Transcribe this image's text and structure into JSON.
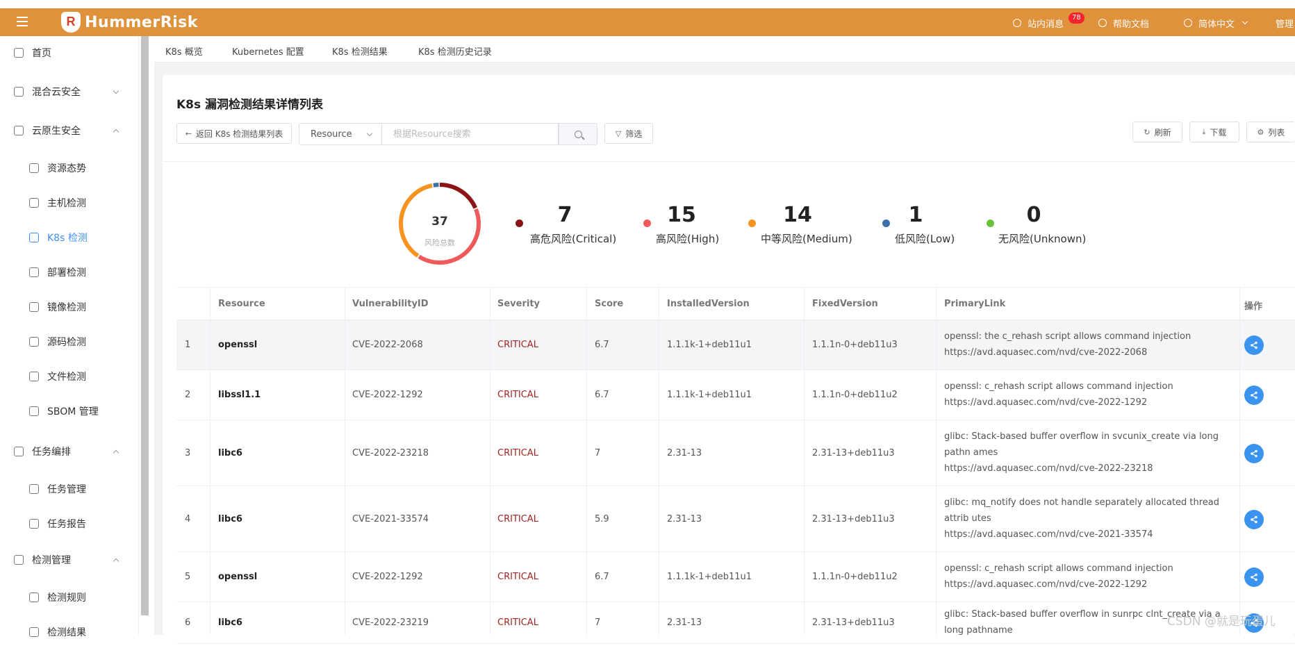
{
  "header": {
    "brand": "HummerRisk",
    "messages_label": "站内消息",
    "messages_count": "78",
    "help_label": "帮助文档",
    "language_label": "简体中文",
    "user_label": "管理"
  },
  "sidebar": {
    "items": [
      {
        "label": "首页",
        "level": "top",
        "icon": "dashboard-icon"
      },
      {
        "label": "混合云安全",
        "level": "top",
        "icon": "cloud-icon",
        "arrow": "down"
      },
      {
        "label": "云原生安全",
        "level": "top",
        "icon": "gear-icon",
        "arrow": "up"
      },
      {
        "label": "资源态势",
        "level": "sub",
        "icon": "shield-icon"
      },
      {
        "label": "主机检测",
        "level": "sub",
        "icon": "server-icon"
      },
      {
        "label": "K8s 检测",
        "level": "sub",
        "icon": "k8s-icon",
        "active": true
      },
      {
        "label": "部署检测",
        "level": "sub",
        "icon": "layers-icon"
      },
      {
        "label": "镜像检测",
        "level": "sub",
        "icon": "container-icon"
      },
      {
        "label": "源码检测",
        "level": "sub",
        "icon": "code-icon"
      },
      {
        "label": "文件检测",
        "level": "sub",
        "icon": "file-icon"
      },
      {
        "label": "SBOM 管理",
        "level": "sub",
        "icon": "checklist-icon"
      },
      {
        "label": "任务编排",
        "level": "top",
        "icon": "list-icon",
        "arrow": "up"
      },
      {
        "label": "任务管理",
        "level": "sub",
        "icon": "task-icon"
      },
      {
        "label": "任务报告",
        "level": "sub",
        "icon": "report-icon"
      },
      {
        "label": "检测管理",
        "level": "top",
        "icon": "grid-icon",
        "arrow": "up"
      },
      {
        "label": "检测规则",
        "level": "sub",
        "icon": "rule-icon"
      },
      {
        "label": "检测结果",
        "level": "sub",
        "icon": "result-icon"
      }
    ]
  },
  "tabs": [
    "K8s 概览",
    "Kubernetes 配置",
    "K8s 检测结果",
    "K8s 检测历史记录"
  ],
  "card": {
    "title": "K8s 漏洞检测结果详情列表",
    "back_label": "返回 K8s 检测结果列表",
    "select_value": "Resource",
    "search_placeholder": "根据Resource搜索",
    "filter_label": "筛选",
    "refresh_label": "刷新",
    "download_label": "下载",
    "columns_label": "列表"
  },
  "summary": {
    "total": "37",
    "total_label": "风险总数",
    "stats": [
      {
        "value": "7",
        "label": "高危风险(Critical)",
        "color": "#8b1414"
      },
      {
        "value": "15",
        "label": "高风险(High)",
        "color": "#f05a5a"
      },
      {
        "value": "14",
        "label": "中等风险(Medium)",
        "color": "#f7931e"
      },
      {
        "value": "1",
        "label": "低风险(Low)",
        "color": "#3d6fa8"
      },
      {
        "value": "0",
        "label": "无风险(Unknown)",
        "color": "#67c23a"
      }
    ]
  },
  "table": {
    "headers": [
      "Resource",
      "VulnerabilityID",
      "Severity",
      "Score",
      "InstalledVersion",
      "FixedVersion",
      "PrimaryLink",
      "操作"
    ],
    "rows": [
      {
        "no": "1",
        "resource": "openssl",
        "vid": "CVE-2022-2068",
        "severity": "CRITICAL",
        "score": "6.7",
        "installed": "1.1.1k-1+deb11u1",
        "fixed": "1.1.1n-0+deb11u3",
        "desc": "openssl: the c_rehash script allows command injection",
        "link": "https://avd.aquasec.com/nvd/cve-2022-2068"
      },
      {
        "no": "2",
        "resource": "libssl1.1",
        "vid": "CVE-2022-1292",
        "severity": "CRITICAL",
        "score": "6.7",
        "installed": "1.1.1k-1+deb11u1",
        "fixed": "1.1.1n-0+deb11u2",
        "desc": "openssl: c_rehash script allows command injection",
        "link": "https://avd.aquasec.com/nvd/cve-2022-1292"
      },
      {
        "no": "3",
        "resource": "libc6",
        "vid": "CVE-2022-23218",
        "severity": "CRITICAL",
        "score": "7",
        "installed": "2.31-13",
        "fixed": "2.31-13+deb11u3",
        "desc": "glibc: Stack-based buffer overflow in svcunix_create via long pathn ames",
        "link": "https://avd.aquasec.com/nvd/cve-2022-23218"
      },
      {
        "no": "4",
        "resource": "libc6",
        "vid": "CVE-2021-33574",
        "severity": "CRITICAL",
        "score": "5.9",
        "installed": "2.31-13",
        "fixed": "2.31-13+deb11u3",
        "desc": "glibc: mq_notify does not handle separately allocated thread attrib utes",
        "link": "https://avd.aquasec.com/nvd/cve-2021-33574"
      },
      {
        "no": "5",
        "resource": "openssl",
        "vid": "CVE-2022-1292",
        "severity": "CRITICAL",
        "score": "6.7",
        "installed": "1.1.1k-1+deb11u1",
        "fixed": "1.1.1n-0+deb11u2",
        "desc": "openssl: c_rehash script allows command injection",
        "link": "https://avd.aquasec.com/nvd/cve-2022-1292"
      },
      {
        "no": "6",
        "resource": "libc6",
        "vid": "CVE-2022-23219",
        "severity": "CRITICAL",
        "score": "7",
        "installed": "2.31-13",
        "fixed": "2.31-13+deb11u3",
        "desc": "glibc: Stack-based buffer overflow in sunrpc clnt_create via a long pathname",
        "link": ""
      }
    ]
  },
  "watermark": "CSDN @就是玩蛋儿"
}
